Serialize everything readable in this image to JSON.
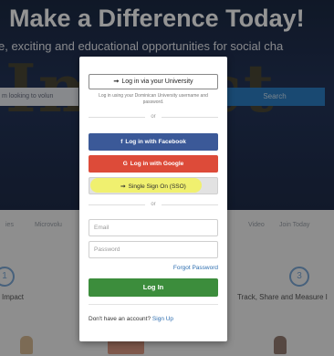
{
  "background": {
    "hero_title": "Make a Difference Today!",
    "hero_subtitle": "e, exciting and educational opportunities for social cha",
    "hero_big_word": "Impact",
    "search_placeholder": "m looking to volun",
    "search_button": "Search",
    "nav_items": [
      "ies",
      "Microvolu",
      "Video",
      "Join Today"
    ],
    "step_numbers": [
      "1",
      "3"
    ],
    "step_labels": [
      "Impact",
      "Track, Share and Measure I"
    ]
  },
  "modal": {
    "university_button": "Log in via your University",
    "university_help": "Log in using your Dominican University username and password.",
    "or_label": "or",
    "facebook_button": "Log in with Facebook",
    "google_button": "Log in with Google",
    "sso_button": "Single Sign On (SSO)",
    "email_placeholder": "Email",
    "password_placeholder": "Password",
    "forgot_password": "Forgot Password",
    "login_button": "Log In",
    "no_account_text": "Don't have an account?",
    "signup_link": "Sign Up"
  },
  "icons": {
    "university": "login-arrow-icon",
    "facebook": "facebook-icon",
    "google": "google-icon",
    "sso": "login-arrow-icon"
  },
  "colors": {
    "facebook": "#3b5998",
    "google": "#dd4b39",
    "login": "#3c8d3c",
    "link": "#2f6fb0",
    "highlight": "#f2f25a"
  }
}
